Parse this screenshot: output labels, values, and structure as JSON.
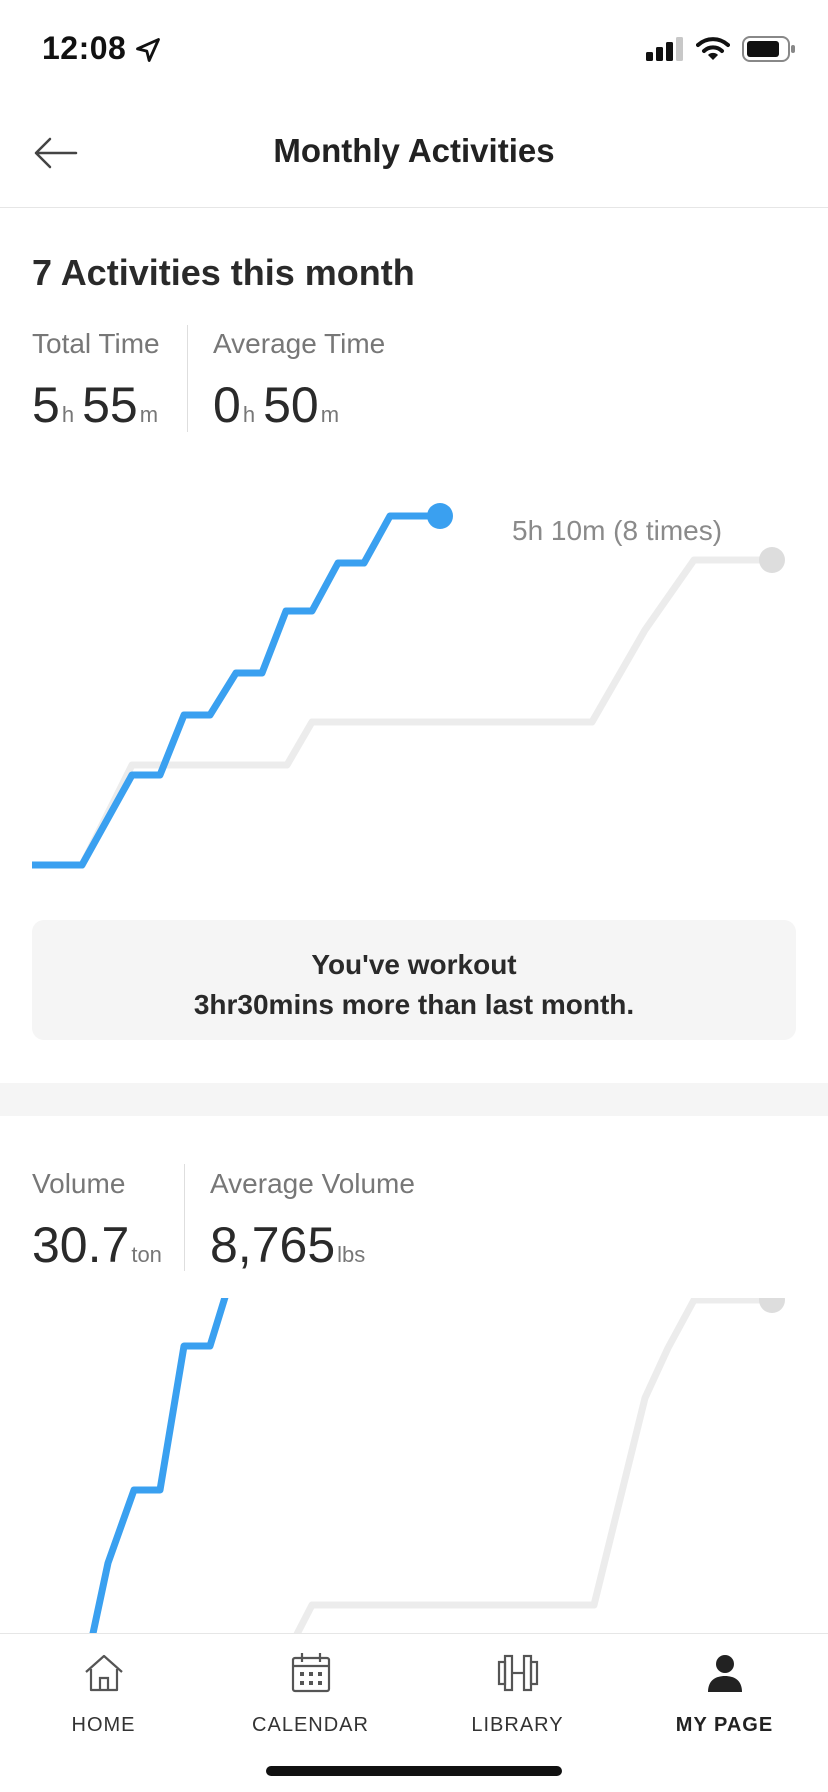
{
  "status": {
    "time": "12:08"
  },
  "header": {
    "title": "Monthly Activities"
  },
  "summary": {
    "title": "7 Activities this month",
    "total_time": {
      "label": "Total Time",
      "hours": "5",
      "h_unit": "h",
      "minutes": "55",
      "m_unit": "m"
    },
    "average_time": {
      "label": "Average Time",
      "hours": "0",
      "h_unit": "h",
      "minutes": "50",
      "m_unit": "m"
    }
  },
  "time_chart_label": "5h 10m (8 times)",
  "message": {
    "line1": "You've workout",
    "line2": "3hr30mins more than last month."
  },
  "volume": {
    "label": "Volume",
    "value": "30.7",
    "unit": "ton",
    "average_label": "Average Volume",
    "average_value": "8,765",
    "average_unit": "lbs"
  },
  "tabs": [
    {
      "label": "HOME",
      "icon": "home-icon",
      "active": false
    },
    {
      "label": "CALENDAR",
      "icon": "calendar-icon",
      "active": false
    },
    {
      "label": "LIBRARY",
      "icon": "library-icon",
      "active": false
    },
    {
      "label": "MY PAGE",
      "icon": "person-icon",
      "active": true
    }
  ],
  "colors": {
    "current_month": "#3aa0f0",
    "last_month": "#ececec",
    "text": "#2b2b2b",
    "muted": "#777777"
  }
}
